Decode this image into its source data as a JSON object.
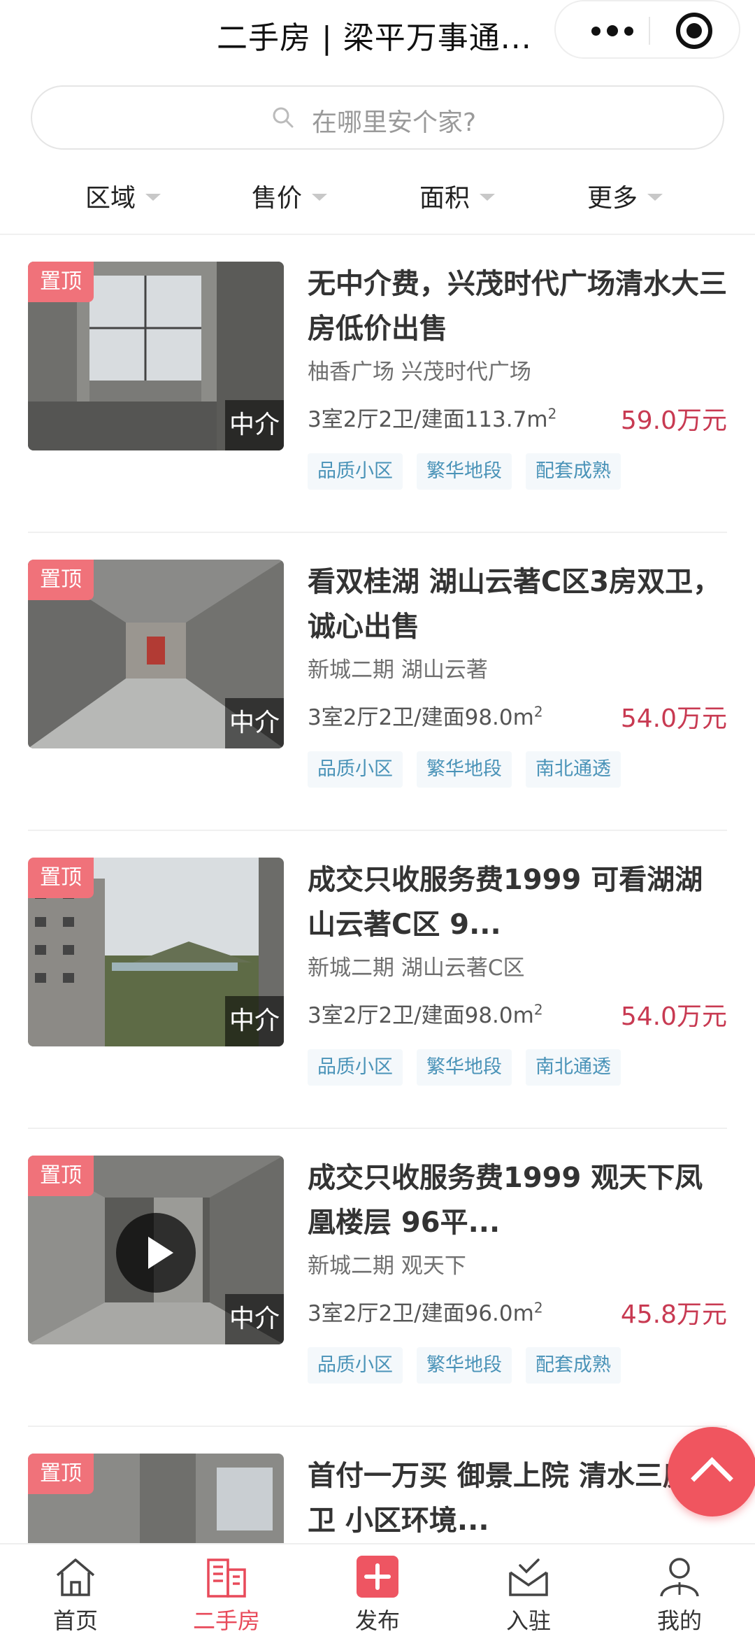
{
  "header": {
    "title": "二手房 | 梁平万事通...",
    "more_icon": "more-dots-icon",
    "close_icon": "mini-program-close-icon"
  },
  "search": {
    "placeholder": "在哪里安个家?"
  },
  "filters": [
    {
      "label": "区域"
    },
    {
      "label": "售价"
    },
    {
      "label": "面积"
    },
    {
      "label": "更多"
    }
  ],
  "listings": [
    {
      "pin": "置顶",
      "agent": "中介",
      "title": "无中介费，兴茂时代广场清水大三房低价出售",
      "location": "柚香广场 兴茂时代广场",
      "spec": "3室2厅2卫/建面113.7m",
      "spec_sup": "2",
      "price": "59.0万元",
      "tags": [
        "品质小区",
        "繁华地段",
        "配套成熟"
      ],
      "has_video": false
    },
    {
      "pin": "置顶",
      "agent": "中介",
      "title": "看双桂湖 湖山云著C区3房双卫，诚心出售",
      "location": "新城二期 湖山云著",
      "spec": "3室2厅2卫/建面98.0m",
      "spec_sup": "2",
      "price": "54.0万元",
      "tags": [
        "品质小区",
        "繁华地段",
        "南北通透"
      ],
      "has_video": false
    },
    {
      "pin": "置顶",
      "agent": "中介",
      "title": "成交只收服务费1999 可看湖湖山云著C区 9...",
      "location": "新城二期 湖山云著C区",
      "spec": "3室2厅2卫/建面98.0m",
      "spec_sup": "2",
      "price": "54.0万元",
      "tags": [
        "品质小区",
        "繁华地段",
        "南北通透"
      ],
      "has_video": false
    },
    {
      "pin": "置顶",
      "agent": "中介",
      "title": "成交只收服务费1999 观天下凤凰楼层 96平...",
      "location": "新城二期 观天下",
      "spec": "3室2厅2卫/建面96.0m",
      "spec_sup": "2",
      "price": "45.8万元",
      "tags": [
        "品质小区",
        "繁华地段",
        "配套成熟"
      ],
      "has_video": true
    },
    {
      "pin": "置顶",
      "agent": "",
      "title": "首付一万买 御景上院 清水三房两卫 小区环境...",
      "location": "",
      "spec": "",
      "spec_sup": "",
      "price": "",
      "tags": [],
      "has_video": false
    }
  ],
  "tabbar": [
    {
      "label": "首页",
      "icon": "home-icon",
      "active": false
    },
    {
      "label": "二手房",
      "icon": "building-icon",
      "active": true
    },
    {
      "label": "发布",
      "icon": "publish-plus-icon",
      "active": false
    },
    {
      "label": "入驻",
      "icon": "inbox-check-icon",
      "active": false
    },
    {
      "label": "我的",
      "icon": "user-icon",
      "active": false
    }
  ],
  "colors": {
    "accent": "#e84a5a",
    "price": "#c83a52",
    "tag_text": "#4a93b8",
    "tag_bg": "#f4f8fb",
    "pin_badge": "#f0727a"
  }
}
